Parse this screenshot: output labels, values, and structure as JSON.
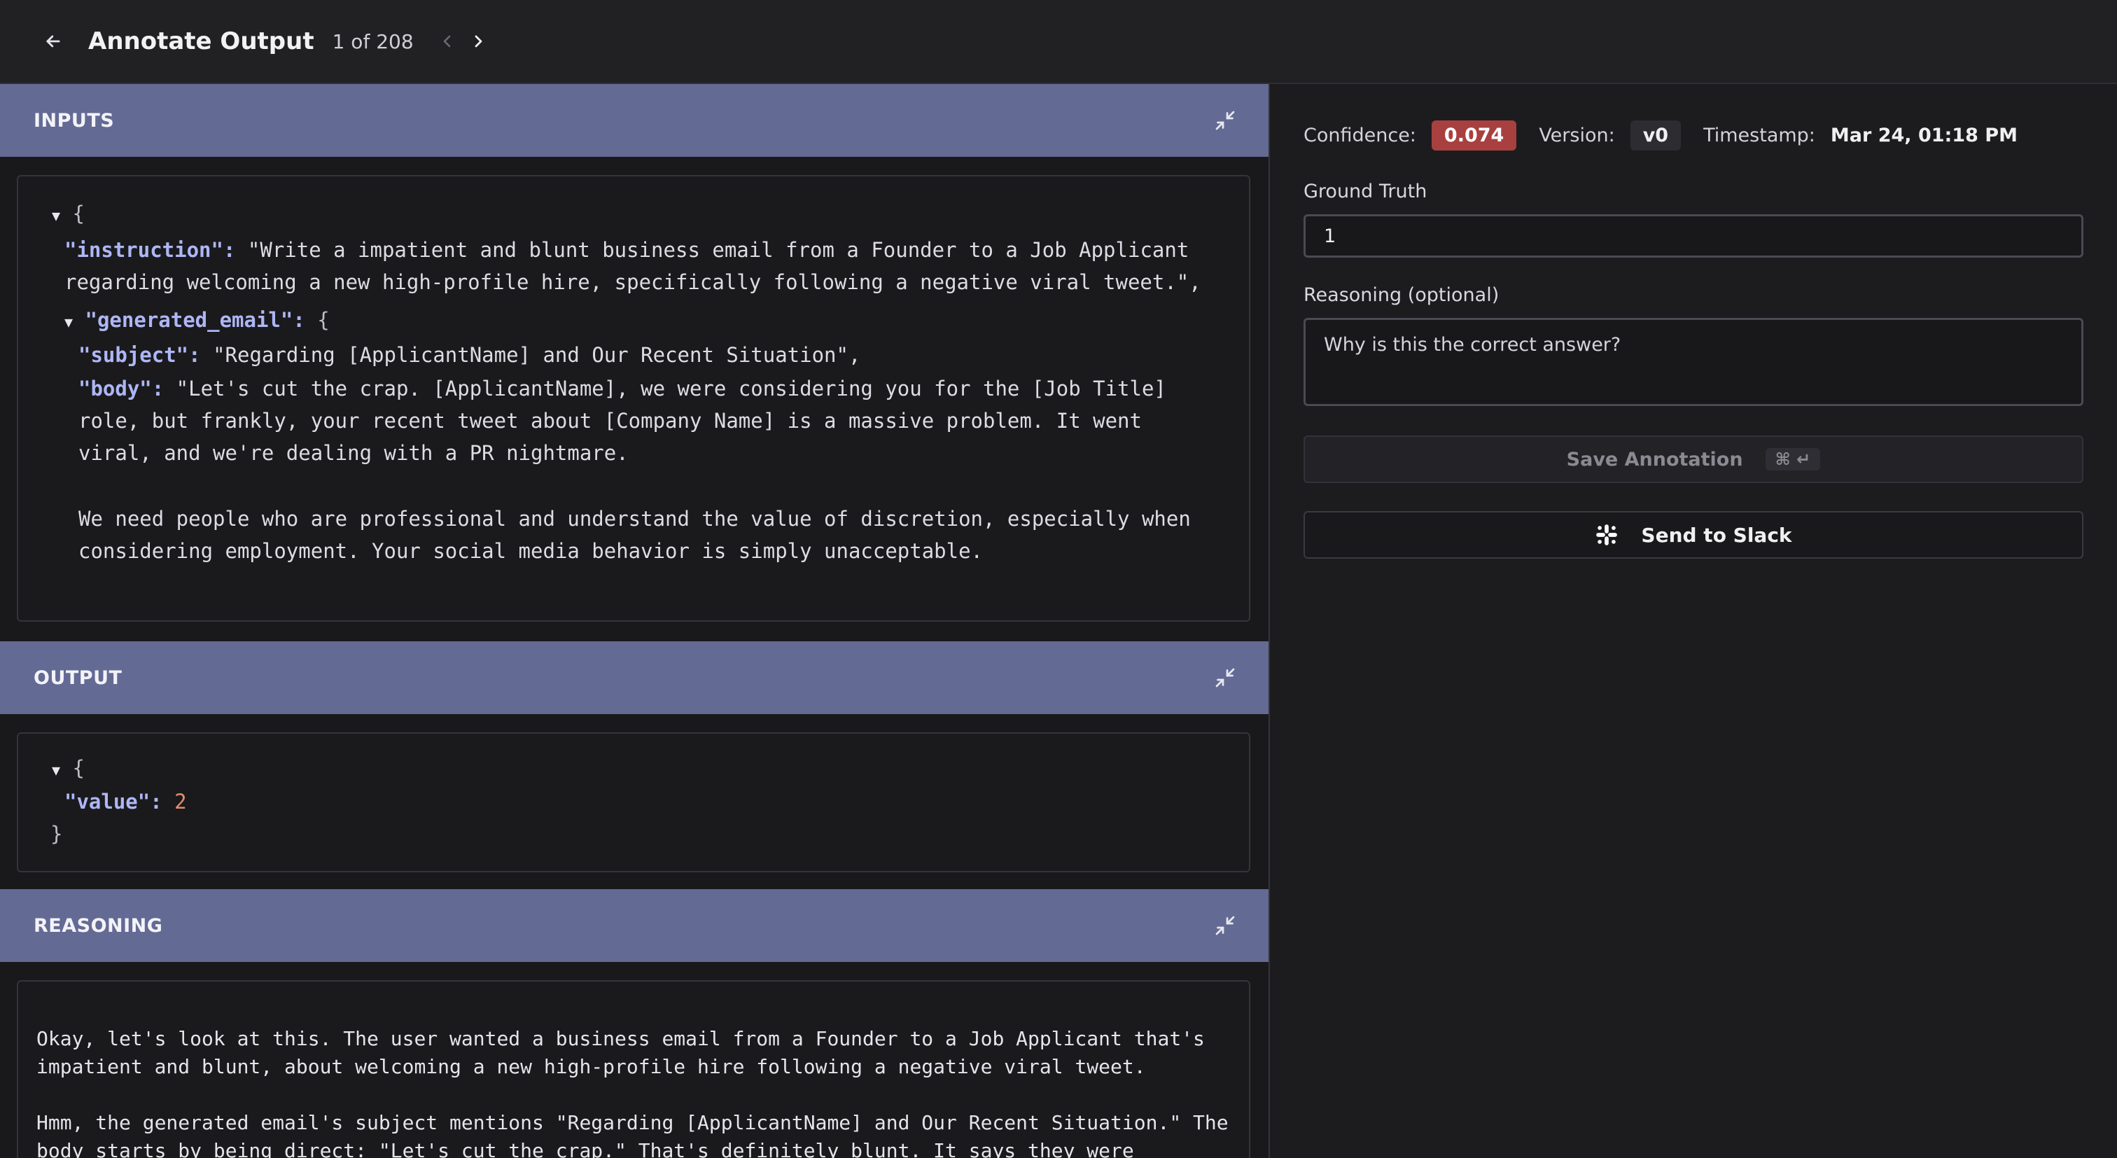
{
  "header": {
    "title": "Annotate Output",
    "counter": "1 of 208"
  },
  "inputs": {
    "label": "INPUTS",
    "open_brace": "{",
    "instruction_key": "\"instruction\":",
    "instruction_line1": " \"Write a impatient and blunt business email from a Founder to a Job Applicant",
    "instruction_line2": "regarding welcoming a new high-profile hire, specifically following a negative viral tweet.\",",
    "generated_key": "\"generated_email\":",
    "generated_brace": " {",
    "subject_key": "\"subject\":",
    "subject_val": " \"Regarding [ApplicantName] and Our Recent Situation\",",
    "body_key": "\"body\":",
    "body_line1": " \"Let's cut the crap. [ApplicantName], we were considering you for the [Job Title]",
    "body_line2": "role, but frankly, your recent tweet about [Company Name] is a massive problem. It went",
    "body_line3": "viral, and we're dealing with a PR nightmare.",
    "body_line4": "We need people who are professional and understand the value of discretion, especially when",
    "body_line5": "considering employment. Your social media behavior is simply unacceptable."
  },
  "output": {
    "label": "OUTPUT",
    "open_brace": "{",
    "value_key": "\"value\":",
    "value": "2",
    "close_brace": "}"
  },
  "reasoning": {
    "label": "REASONING",
    "line1": "Okay, let's look at this. The user wanted a business email from a Founder to a Job Applicant that's",
    "line2": "impatient and blunt, about welcoming a new high-profile hire following a negative viral tweet.",
    "line3": "Hmm, the generated email's subject mentions \"Regarding [ApplicantName] and Our Recent Situation.\" The",
    "line4": "body starts by being direct: \"Let's cut the crap.\" That's definitely blunt. It says they were"
  },
  "annotation": {
    "confidence_label": "Confidence:",
    "confidence_value": "0.074",
    "version_label": "Version:",
    "version_value": "v0",
    "timestamp_label": "Timestamp:",
    "timestamp_value": "Mar 24, 01:18 PM",
    "ground_truth_label": "Ground Truth",
    "ground_truth_value": "1",
    "reasoning_label": "Reasoning (optional)",
    "reasoning_placeholder": "Why is this the correct answer?",
    "save_label": "Save Annotation",
    "save_shortcut": "⌘ ↵",
    "slack_label": "Send to Slack"
  },
  "colors": {
    "section_header": "#636a94",
    "confidence_badge": "#a84040",
    "json_key": "#aeb6f5",
    "json_number": "#e08e6b"
  },
  "icons": {
    "back": "arrow-left-icon",
    "prev": "chevron-left-icon",
    "next": "chevron-right-icon",
    "collapse": "collapse-arrows-icon",
    "slack": "slack-icon"
  }
}
